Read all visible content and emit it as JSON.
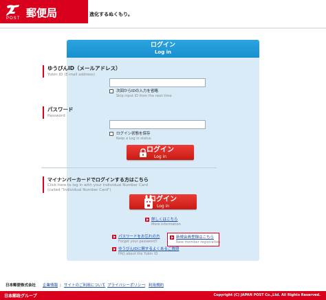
{
  "header": {
    "brand_post": "POST",
    "brand_name": "郵便局",
    "tagline": "進化するぬくもり。"
  },
  "login_card": {
    "title_jp": "ログイン",
    "title_en": "Log in",
    "id_field": {
      "label_jp": "ゆうびんID（メールアドレス）",
      "label_en": "Yubin ID (E-mail address)",
      "value": ""
    },
    "skip_id": {
      "label_jp": "次回からIDの入力を省略",
      "label_en": "Skip input ID from the next time",
      "checked": false
    },
    "password_field": {
      "label_jp": "パスワード",
      "label_en": "Password",
      "value": ""
    },
    "keep_login": {
      "label_jp": "ログイン状態を保存",
      "label_en": "Keep a Log in status",
      "checked": false
    },
    "login_button": {
      "label_jp": "ログイン",
      "label_en": "Log in",
      "icon": "lock-icon"
    },
    "mynumber": {
      "heading_jp": "マイナンバーカードでログインする方はこちら",
      "heading_en_1": "Click here to log in with your Individual Number Card",
      "heading_en_2": "(called \"Individual Number Card\")",
      "button_label_jp": "ログイン",
      "button_label_en": "Log in",
      "icon": "mynumber-card-character-icon"
    },
    "details_link": {
      "label_jp": "詳しくはこちら",
      "label_en": "More information"
    },
    "forgot_password": {
      "label_jp": "パスワードをお忘れの方",
      "label_en": "Forget your password?"
    },
    "new_member": {
      "label_jp": "新規会員登録はこちら",
      "label_en": "New member registration"
    },
    "faq": {
      "label_jp": "ゆうびんIDに関するよくあるご質問",
      "label_en": "FAQ about the Yubin ID"
    }
  },
  "footer": {
    "company": "日本郵便株式会社",
    "links": [
      "企業情報",
      "サイトのご利用について",
      "プライバシーポリシー",
      "利用規約"
    ],
    "group": "日本郵政グループ",
    "copyright": "Copyright (C) JAPAN POST Co.,Ltd.  All Rights Reserved."
  },
  "colors": {
    "brand_red": "#d8001d",
    "card_bg": "#d8ebf7",
    "card_header": "#1a8fd0",
    "link_blue": "#1a4aa0"
  }
}
